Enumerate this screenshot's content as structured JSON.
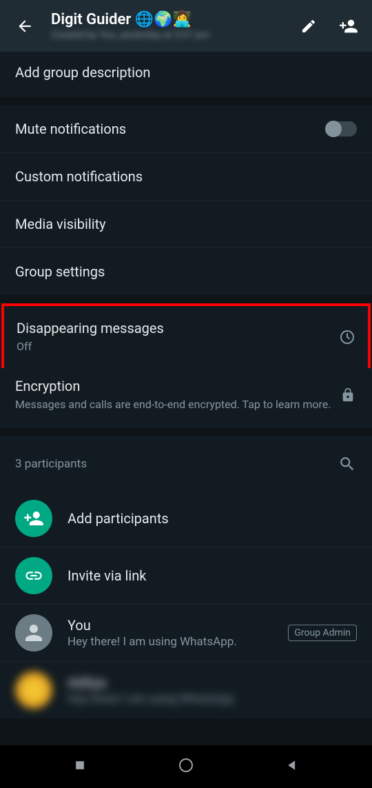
{
  "header": {
    "title": "Digit Guider 🌐🌍👩‍💻",
    "subtitle": "Created by You, yesterday at 3:07 pm"
  },
  "description": {
    "text": "Add group description"
  },
  "settings": {
    "mute": {
      "label": "Mute notifications"
    },
    "custom": {
      "label": "Custom notifications"
    },
    "media": {
      "label": "Media visibility"
    },
    "group": {
      "label": "Group settings"
    },
    "disappearing": {
      "label": "Disappearing messages",
      "value": "Off"
    },
    "encryption": {
      "label": "Encryption",
      "sub": "Messages and calls are end-to-end encrypted. Tap to learn more."
    }
  },
  "participants": {
    "count": "3 participants",
    "add": "Add participants",
    "invite": "Invite via link",
    "you": {
      "name": "You",
      "status": "Hey there! I am using WhatsApp.",
      "badge": "Group Admin"
    },
    "blurred": {
      "name": "Aditya",
      "status": "Hey there! I am using WhatsApp."
    }
  }
}
